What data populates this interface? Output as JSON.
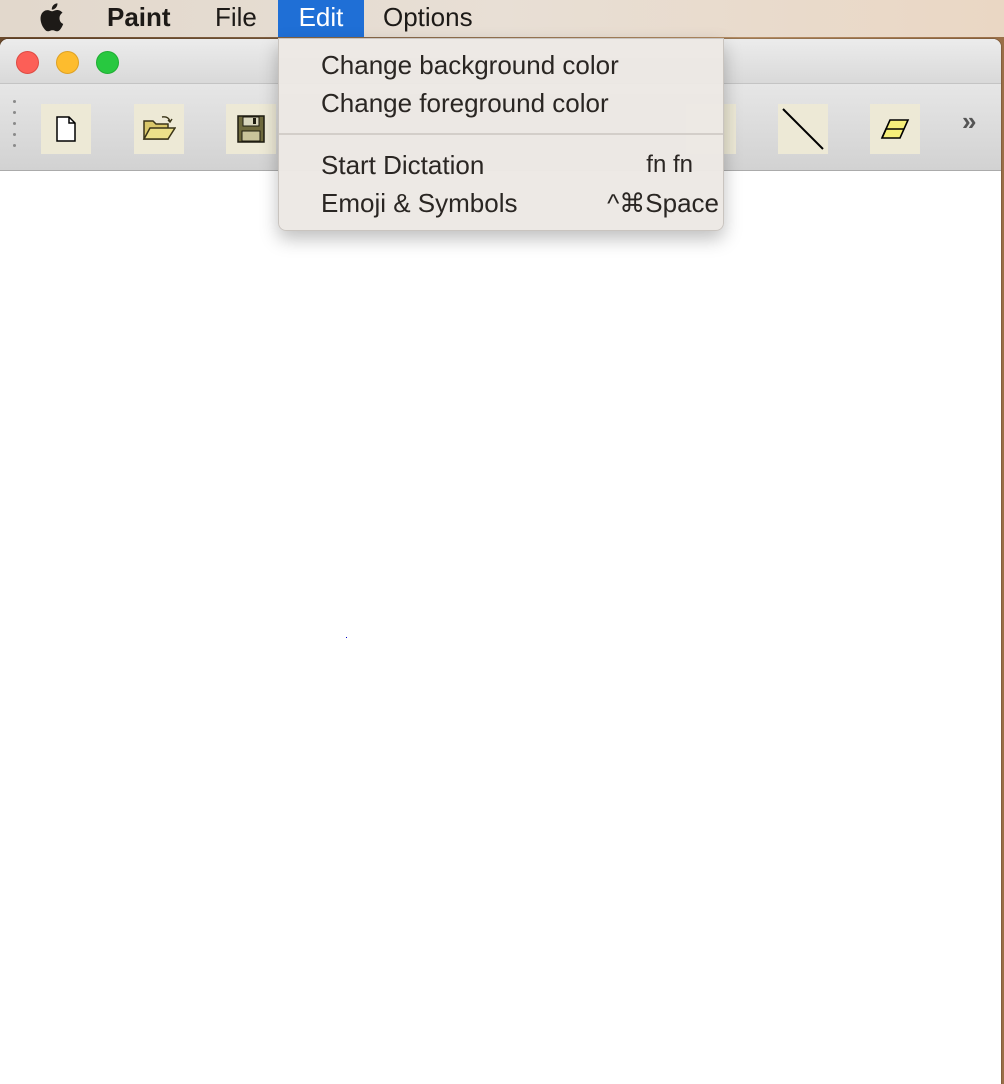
{
  "menubar": {
    "apple_icon": "apple-icon",
    "app_name": "Paint",
    "items": [
      "File",
      "Edit",
      "Options"
    ]
  },
  "window": {
    "toolbar": {
      "tools": [
        "new-file-icon",
        "open-folder-icon",
        "save-disk-icon",
        "line-tool-icon",
        "eraser-icon"
      ],
      "overflow": "»"
    }
  },
  "edit_menu": {
    "items": [
      {
        "label": "Change background color",
        "shortcut": ""
      },
      {
        "label": "Change foreground color",
        "shortcut": ""
      },
      {
        "label": "Start Dictation",
        "shortcut": "fn fn"
      },
      {
        "label": "Emoji & Symbols",
        "shortcut": "^⌘Space"
      }
    ]
  },
  "colors": {
    "menu_highlight": "#1f6fd6",
    "close": "#fc5f57",
    "minimize": "#fdbc2e",
    "maximize": "#28c840",
    "tool_bg": "#ede9d6"
  }
}
